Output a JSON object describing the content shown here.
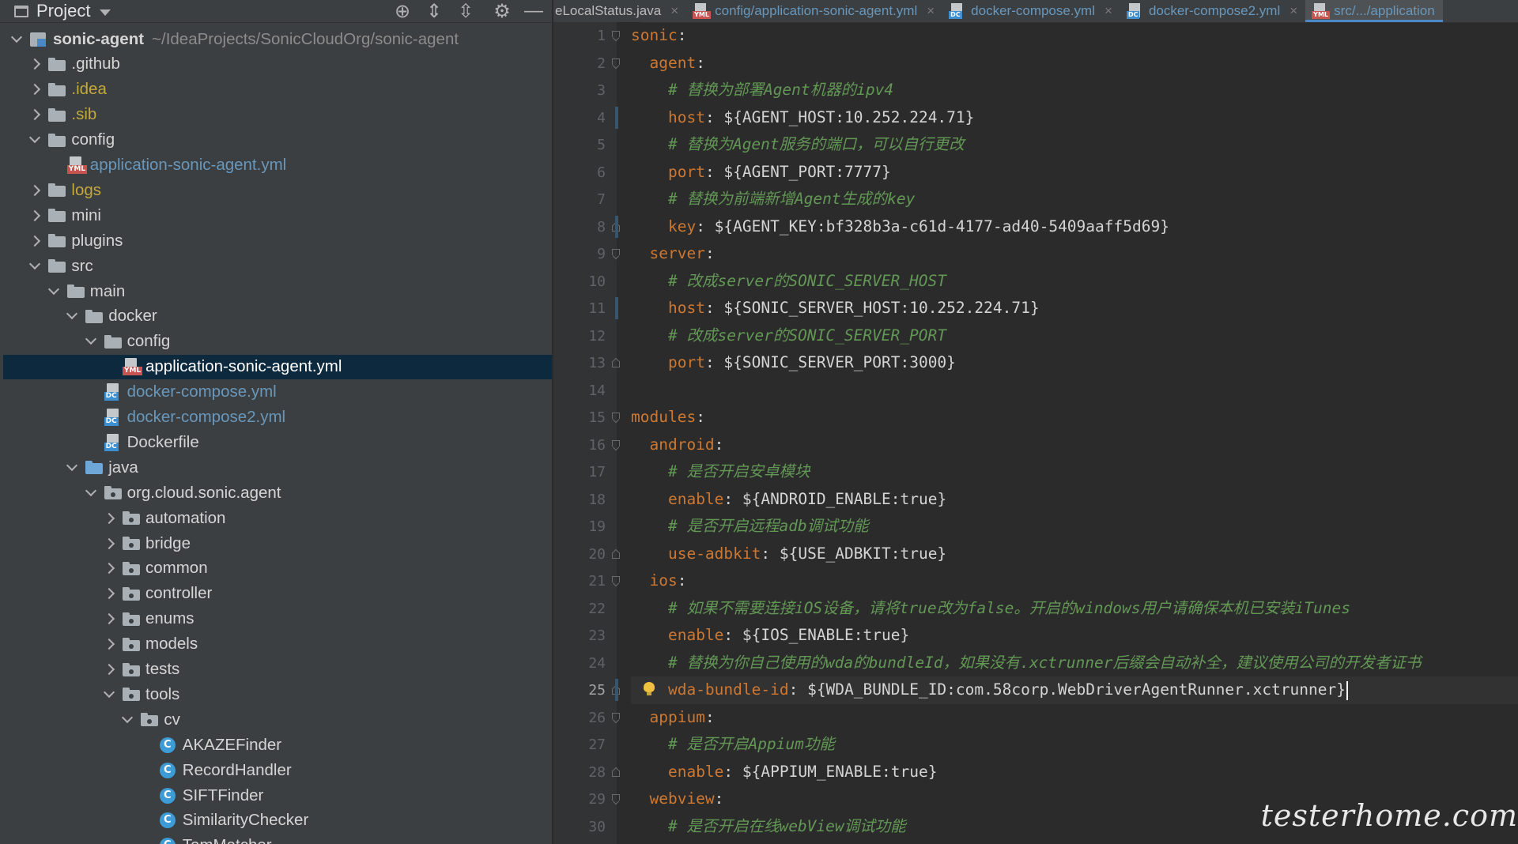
{
  "project_panel": {
    "title": "Project",
    "toolbar_icons": [
      "locate-icon",
      "expand-all-icon",
      "collapse-all-icon",
      "gear-icon",
      "hide-icon"
    ]
  },
  "tree": [
    {
      "label": "sonic-agent",
      "path": "~/IdeaProjects/SonicCloudOrg/sonic-agent",
      "depth": 0,
      "chevron": "down",
      "icon": "module",
      "style": "bold"
    },
    {
      "label": ".github",
      "depth": 1,
      "chevron": "right",
      "icon": "folder"
    },
    {
      "label": ".idea",
      "depth": 1,
      "chevron": "right",
      "icon": "folder",
      "style": "ignored"
    },
    {
      "label": ".sib",
      "depth": 1,
      "chevron": "right",
      "icon": "folder",
      "style": "ignored"
    },
    {
      "label": "config",
      "depth": 1,
      "chevron": "down",
      "icon": "folder"
    },
    {
      "label": "application-sonic-agent.yml",
      "depth": 2,
      "chevron": "none",
      "icon": "yml",
      "style": "link"
    },
    {
      "label": "logs",
      "depth": 1,
      "chevron": "right",
      "icon": "folder",
      "style": "ignored"
    },
    {
      "label": "mini",
      "depth": 1,
      "chevron": "right",
      "icon": "folder"
    },
    {
      "label": "plugins",
      "depth": 1,
      "chevron": "right",
      "icon": "folder"
    },
    {
      "label": "src",
      "depth": 1,
      "chevron": "down",
      "icon": "folder"
    },
    {
      "label": "main",
      "depth": 2,
      "chevron": "down",
      "icon": "folder"
    },
    {
      "label": "docker",
      "depth": 3,
      "chevron": "down",
      "icon": "folder"
    },
    {
      "label": "config",
      "depth": 4,
      "chevron": "down",
      "icon": "folder"
    },
    {
      "label": "application-sonic-agent.yml",
      "depth": 5,
      "chevron": "none",
      "icon": "yml",
      "style": "selected"
    },
    {
      "label": "docker-compose.yml",
      "depth": 4,
      "chevron": "none",
      "icon": "dc",
      "style": "link"
    },
    {
      "label": "docker-compose2.yml",
      "depth": 4,
      "chevron": "none",
      "icon": "dc",
      "style": "link"
    },
    {
      "label": "Dockerfile",
      "depth": 4,
      "chevron": "none",
      "icon": "dc"
    },
    {
      "label": "java",
      "depth": 3,
      "chevron": "down",
      "icon": "folder-blue"
    },
    {
      "label": "org.cloud.sonic.agent",
      "depth": 4,
      "chevron": "down",
      "icon": "package"
    },
    {
      "label": "automation",
      "depth": 5,
      "chevron": "right",
      "icon": "package"
    },
    {
      "label": "bridge",
      "depth": 5,
      "chevron": "right",
      "icon": "package"
    },
    {
      "label": "common",
      "depth": 5,
      "chevron": "right",
      "icon": "package"
    },
    {
      "label": "controller",
      "depth": 5,
      "chevron": "right",
      "icon": "package"
    },
    {
      "label": "enums",
      "depth": 5,
      "chevron": "right",
      "icon": "package"
    },
    {
      "label": "models",
      "depth": 5,
      "chevron": "right",
      "icon": "package"
    },
    {
      "label": "tests",
      "depth": 5,
      "chevron": "right",
      "icon": "package"
    },
    {
      "label": "tools",
      "depth": 5,
      "chevron": "down",
      "icon": "package"
    },
    {
      "label": "cv",
      "depth": 6,
      "chevron": "down",
      "icon": "package"
    },
    {
      "label": "AKAZEFinder",
      "depth": 7,
      "chevron": "none",
      "icon": "class"
    },
    {
      "label": "RecordHandler",
      "depth": 7,
      "chevron": "none",
      "icon": "class"
    },
    {
      "label": "SIFTFinder",
      "depth": 7,
      "chevron": "none",
      "icon": "class"
    },
    {
      "label": "SimilarityChecker",
      "depth": 7,
      "chevron": "none",
      "icon": "class"
    },
    {
      "label": "TemMatcher",
      "depth": 7,
      "chevron": "none",
      "icon": "class"
    }
  ],
  "tabs": [
    {
      "label": "eLocalStatus.java",
      "icon": "none",
      "close": "×",
      "color": "plain"
    },
    {
      "label": "config/application-sonic-agent.yml",
      "icon": "yml",
      "close": "×",
      "color": "blue"
    },
    {
      "label": "docker-compose.yml",
      "icon": "dc",
      "close": "×",
      "color": "blue"
    },
    {
      "label": "docker-compose2.yml",
      "icon": "dc",
      "close": "×",
      "color": "blue"
    },
    {
      "label": "src/.../application",
      "icon": "yml",
      "close": "",
      "color": "blue",
      "active": true
    }
  ],
  "editor": {
    "current_line": 25,
    "lines": [
      [
        {
          "t": "k",
          "s": "sonic"
        },
        {
          "t": "v",
          "s": ":"
        }
      ],
      [
        {
          "t": "v",
          "s": "  "
        },
        {
          "t": "k",
          "s": "agent"
        },
        {
          "t": "v",
          "s": ":"
        }
      ],
      [
        {
          "t": "v",
          "s": "    "
        },
        {
          "t": "c",
          "s": "# 替换为部署Agent机器的ipv4"
        }
      ],
      [
        {
          "t": "v",
          "s": "    "
        },
        {
          "t": "k",
          "s": "host"
        },
        {
          "t": "v",
          "s": ": ${AGENT_HOST:10.252.224.71}"
        }
      ],
      [
        {
          "t": "v",
          "s": "    "
        },
        {
          "t": "c",
          "s": "# 替换为Agent服务的端口，可以自行更改"
        }
      ],
      [
        {
          "t": "v",
          "s": "    "
        },
        {
          "t": "k",
          "s": "port"
        },
        {
          "t": "v",
          "s": ": ${AGENT_PORT:7777}"
        }
      ],
      [
        {
          "t": "v",
          "s": "    "
        },
        {
          "t": "c",
          "s": "# 替换为前端新增Agent生成的key"
        }
      ],
      [
        {
          "t": "v",
          "s": "    "
        },
        {
          "t": "k",
          "s": "key"
        },
        {
          "t": "v",
          "s": ": ${AGENT_KEY:bf328b3a-c61d-4177-ad40-5409aaff5d69}"
        }
      ],
      [
        {
          "t": "v",
          "s": "  "
        },
        {
          "t": "k",
          "s": "server"
        },
        {
          "t": "v",
          "s": ":"
        }
      ],
      [
        {
          "t": "v",
          "s": "    "
        },
        {
          "t": "c",
          "s": "# 改成server的SONIC_SERVER_HOST"
        }
      ],
      [
        {
          "t": "v",
          "s": "    "
        },
        {
          "t": "k",
          "s": "host"
        },
        {
          "t": "v",
          "s": ": ${SONIC_SERVER_HOST:10.252.224.71}"
        }
      ],
      [
        {
          "t": "v",
          "s": "    "
        },
        {
          "t": "c",
          "s": "# 改成server的SONIC_SERVER_PORT"
        }
      ],
      [
        {
          "t": "v",
          "s": "    "
        },
        {
          "t": "k",
          "s": "port"
        },
        {
          "t": "v",
          "s": ": ${SONIC_SERVER_PORT:3000}"
        }
      ],
      [],
      [
        {
          "t": "k",
          "s": "modules"
        },
        {
          "t": "v",
          "s": ":"
        }
      ],
      [
        {
          "t": "v",
          "s": "  "
        },
        {
          "t": "k",
          "s": "android"
        },
        {
          "t": "v",
          "s": ":"
        }
      ],
      [
        {
          "t": "v",
          "s": "    "
        },
        {
          "t": "c",
          "s": "# 是否开启安卓模块"
        }
      ],
      [
        {
          "t": "v",
          "s": "    "
        },
        {
          "t": "k",
          "s": "enable"
        },
        {
          "t": "v",
          "s": ": ${ANDROID_ENABLE:true}"
        }
      ],
      [
        {
          "t": "v",
          "s": "    "
        },
        {
          "t": "c",
          "s": "# 是否开启远程adb调试功能"
        }
      ],
      [
        {
          "t": "v",
          "s": "    "
        },
        {
          "t": "k",
          "s": "use-adbkit"
        },
        {
          "t": "v",
          "s": ": ${USE_ADBKIT:true}"
        }
      ],
      [
        {
          "t": "v",
          "s": "  "
        },
        {
          "t": "k",
          "s": "ios"
        },
        {
          "t": "v",
          "s": ":"
        }
      ],
      [
        {
          "t": "v",
          "s": "    "
        },
        {
          "t": "c",
          "s": "# 如果不需要连接iOS设备，请将true改为false。开启的windows用户请确保本机已安装iTunes"
        }
      ],
      [
        {
          "t": "v",
          "s": "    "
        },
        {
          "t": "k",
          "s": "enable"
        },
        {
          "t": "v",
          "s": ": ${IOS_ENABLE:true}"
        }
      ],
      [
        {
          "t": "v",
          "s": "    "
        },
        {
          "t": "c",
          "s": "# 替换为你自己使用的wda的bundleId，如果没有.xctrunner后缀会自动补全，建议使用公司的开发者证书"
        }
      ],
      [
        {
          "t": "v",
          "s": "    "
        },
        {
          "t": "k",
          "s": "wda-bundle-id"
        },
        {
          "t": "v",
          "s": ": ${WDA_BUNDLE_ID:com.58corp.WebDriverAgentRunner.xctrunner}"
        }
      ],
      [
        {
          "t": "v",
          "s": "  "
        },
        {
          "t": "k",
          "s": "appium"
        },
        {
          "t": "v",
          "s": ":"
        }
      ],
      [
        {
          "t": "v",
          "s": "    "
        },
        {
          "t": "c",
          "s": "# 是否开启Appium功能"
        }
      ],
      [
        {
          "t": "v",
          "s": "    "
        },
        {
          "t": "k",
          "s": "enable"
        },
        {
          "t": "v",
          "s": ": ${APPIUM_ENABLE:true}"
        }
      ],
      [
        {
          "t": "v",
          "s": "  "
        },
        {
          "t": "k",
          "s": "webview"
        },
        {
          "t": "v",
          "s": ":"
        }
      ],
      [
        {
          "t": "v",
          "s": "    "
        },
        {
          "t": "c",
          "s": "# 是否开启在线webView调试功能"
        }
      ]
    ],
    "fold_markers": {
      "1": "open",
      "2": "open",
      "8": "close",
      "9": "open",
      "13": "close",
      "15": "open",
      "16": "open",
      "20": "close",
      "21": "open",
      "25": "close",
      "26": "open",
      "28": "close",
      "29": "open"
    },
    "change_markers": [
      4,
      8,
      11,
      25
    ],
    "intention_bulb_line": 25
  },
  "watermark": "testerhome.com"
}
